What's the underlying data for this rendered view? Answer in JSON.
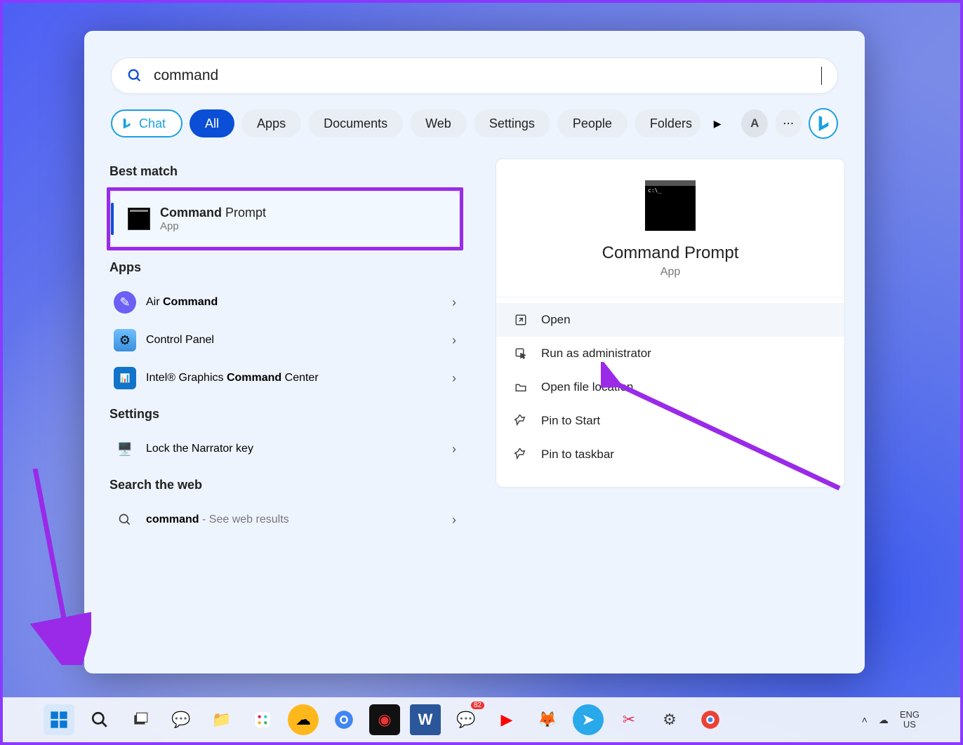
{
  "search": {
    "value": "command",
    "placeholder": ""
  },
  "filters": {
    "chat": "Chat",
    "items": [
      "All",
      "Apps",
      "Documents",
      "Web",
      "Settings",
      "People",
      "Folders"
    ],
    "active": "All",
    "user_initial": "A",
    "more": "⋯"
  },
  "results": {
    "best_match_label": "Best match",
    "best": {
      "title_bold": "Command",
      "title_rest": " Prompt",
      "subtitle": "App"
    },
    "apps_label": "Apps",
    "apps": [
      {
        "prefix": "Air ",
        "bold": "Command",
        "rest": ""
      },
      {
        "prefix": "",
        "bold": "",
        "rest": "Control Panel"
      },
      {
        "prefix": "Intel® Graphics ",
        "bold": "Command",
        "rest": " Center"
      }
    ],
    "settings_label": "Settings",
    "settings": [
      {
        "label": "Lock the Narrator key"
      }
    ],
    "web_label": "Search the web",
    "web": {
      "bold": "command",
      "rest": " - See web results"
    }
  },
  "detail": {
    "title": "Command Prompt",
    "subtitle": "App",
    "actions": [
      {
        "icon": "open-icon",
        "label": "Open",
        "selected": true
      },
      {
        "icon": "admin-icon",
        "label": "Run as administrator",
        "selected": false
      },
      {
        "icon": "folder-icon",
        "label": "Open file location",
        "selected": false
      },
      {
        "icon": "pin-start-icon",
        "label": "Pin to Start",
        "selected": false
      },
      {
        "icon": "pin-taskbar-icon",
        "label": "Pin to taskbar",
        "selected": false
      }
    ]
  },
  "taskbar": {
    "lang_top": "ENG",
    "lang_bottom": "US"
  }
}
